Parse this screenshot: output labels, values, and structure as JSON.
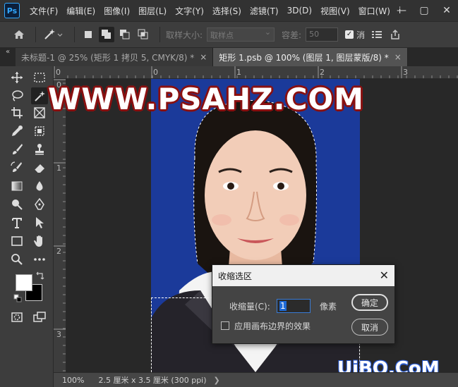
{
  "menubar": {
    "logo": "Ps",
    "items": [
      "文件(F)",
      "编辑(E)",
      "图像(I)",
      "图层(L)",
      "文字(Y)",
      "选择(S)",
      "滤镜(T)",
      "3D(D)",
      "视图(V)",
      "窗口(W)",
      "i"
    ],
    "win_min": "—",
    "win_max": "▢",
    "win_close": "✕"
  },
  "options": {
    "sample_size_label": "取样大小:",
    "sample_size_value": "取样点",
    "tolerance_label": "容差:",
    "tolerance_value": "50",
    "antialias_label": "消",
    "share_icon": "share-icon"
  },
  "tabs": [
    {
      "label": "未标题-1 @ 25% (矩形 1 拷贝 5, CMYK/8) *",
      "active": false
    },
    {
      "label": "矩形 1.psb @ 100% (图层 1, 图层蒙版/8) *",
      "active": true
    }
  ],
  "tab_close": "×",
  "collapse": "«",
  "ruler": {
    "top": [
      "0",
      "0",
      "1",
      "2",
      "3"
    ],
    "left": [
      "0",
      "1",
      "2",
      "3"
    ]
  },
  "watermarks": {
    "top": "WWW.PSAHZ.COM",
    "bottom": "UiBQ.CoM"
  },
  "status": {
    "zoom": "100%",
    "doc_size": "2.5 厘米 x 3.5 厘米 (300 ppi)",
    "arrow": "❯"
  },
  "dialog": {
    "title": "收缩选区",
    "close": "✕",
    "contract_label": "收缩量(C):",
    "contract_value": "1",
    "unit": "像素",
    "apply_canvas_label": "应用画布边界的效果",
    "ok_label": "确定",
    "cancel_label": "取消"
  },
  "colors": {
    "photo_bg": "#1b3a9a",
    "accent": "#31a8ff"
  }
}
